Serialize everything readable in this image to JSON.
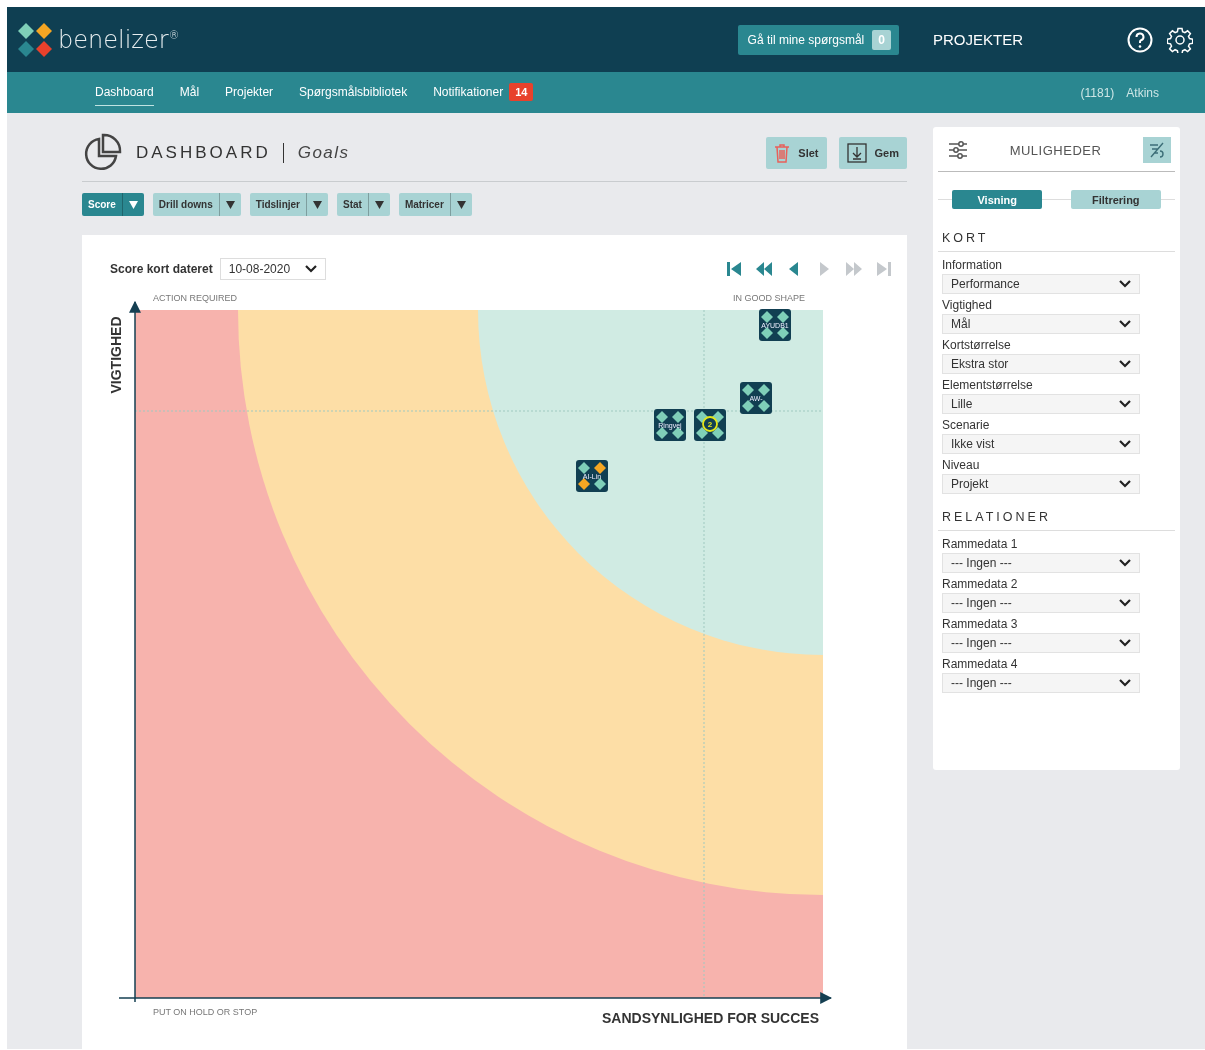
{
  "header": {
    "logo": "benelizer$^{®}$",
    "questions_button": {
      "label": "Gå til mine spørgsmål",
      "count": "0"
    },
    "section_title": "PROJEKTER"
  },
  "nav": {
    "items": [
      {
        "label": "Dashboard",
        "selected": true
      },
      {
        "label": "Mål",
        "selected": false
      },
      {
        "label": "Projekter",
        "selected": false
      },
      {
        "label": "Spørgsmålsbibliotek",
        "selected": false
      },
      {
        "label": "Notifikationer",
        "selected": false,
        "badge": "14"
      }
    ],
    "user_id": "(1181)",
    "user_name": "Atkins"
  },
  "dashboard": {
    "title": "DASHBOARD",
    "subtitle": "Goals",
    "actions": [
      {
        "kind": "delete",
        "label": "Slet"
      },
      {
        "kind": "save",
        "label": "Gem"
      }
    ],
    "filters": [
      {
        "label": "Score",
        "selected": true
      },
      {
        "label": "Drill downs",
        "selected": false
      },
      {
        "label": "Tidslinjer",
        "selected": false
      },
      {
        "label": "Stat",
        "selected": false
      },
      {
        "label": "Matricer",
        "selected": false
      }
    ]
  },
  "chart": {
    "date_label": "Score kort dateret",
    "date_value": "10-08-2020",
    "pager": [
      {
        "kind": "first",
        "disabled": false
      },
      {
        "kind": "rewind",
        "disabled": false
      },
      {
        "kind": "prev",
        "disabled": false
      },
      {
        "kind": "next",
        "disabled": true
      },
      {
        "kind": "forward",
        "disabled": true
      },
      {
        "kind": "last",
        "disabled": true
      }
    ],
    "top_left_label": "ACTION REQUIRED",
    "top_right_label": "IN GOOD SHAPE",
    "bottom_left_label": "PUT ON HOLD OR STOP",
    "y_axis_label": "VIGTIGHED",
    "x_axis_label": "SANDSYNLIGHED FOR SUCCES",
    "markers": [
      {
        "label": "AYUDB1",
        "kind": "card"
      },
      {
        "label": "AW-",
        "kind": "card"
      },
      {
        "label": "Ringvej",
        "kind": "card"
      },
      {
        "label": "2",
        "kind": "cluster"
      },
      {
        "label": "AI-Lin",
        "kind": "warning"
      }
    ]
  },
  "options": {
    "title": "MULIGHEDER",
    "tabs": [
      {
        "label": "Visning",
        "selected": true
      },
      {
        "label": "Filtrering",
        "selected": false
      }
    ],
    "sections": [
      {
        "title": "KORT",
        "fields": [
          {
            "label": "Information",
            "value": "Performance"
          },
          {
            "label": "Vigtighed",
            "value": "Mål"
          },
          {
            "label": "Kortstørrelse",
            "value": "Ekstra stor"
          },
          {
            "label": "Elementstørrelse",
            "value": "Lille"
          },
          {
            "label": "Scenarie",
            "value": "Ikke vist"
          },
          {
            "label": "Niveau",
            "value": "Projekt"
          }
        ]
      },
      {
        "title": "RELATIONER",
        "fields": [
          {
            "label": "Rammedata 1",
            "value": "--- Ingen ---"
          },
          {
            "label": "Rammedata 2",
            "value": "--- Ingen ---"
          },
          {
            "label": "Rammedata 3",
            "value": "--- Ingen ---"
          },
          {
            "label": "Rammedata 4",
            "value": "--- Ingen ---"
          }
        ]
      }
    ]
  }
}
